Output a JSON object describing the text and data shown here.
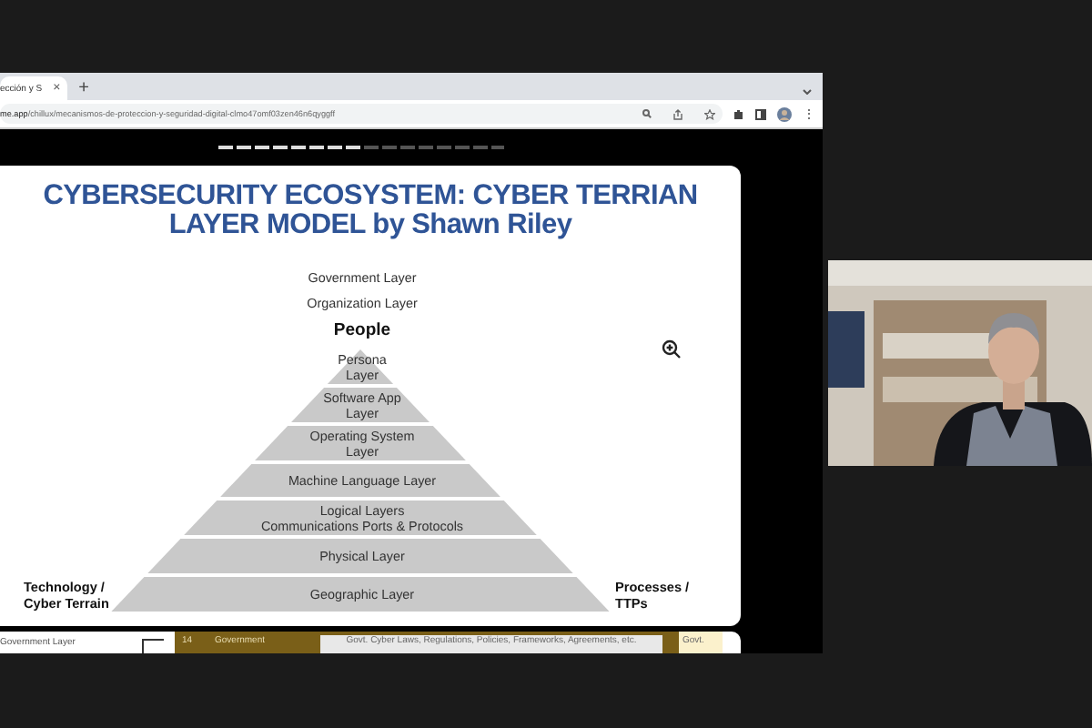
{
  "browser": {
    "tab_title": "ección y S",
    "tab_close": "×",
    "new_tab": "+",
    "url_host": "me.app",
    "url_path": "/chillux/mecanismos-de-proteccion-y-seguridad-digital-clmo47omf03zen46n6qyggff",
    "menu": "⋮"
  },
  "slide_progress": {
    "level": 0.5
  },
  "slide": {
    "title": "CYBERSECURITY ECOSYSTEM: CYBER TERRIAN LAYER MODEL by Shawn Riley",
    "top_labels": [
      {
        "text": "Government Layer",
        "kind": "plain"
      },
      {
        "text": "Organization Layer",
        "kind": "plain"
      },
      {
        "text": "People",
        "kind": "heading"
      }
    ],
    "layers": [
      {
        "lines": [
          "Persona",
          "Layer"
        ]
      },
      {
        "lines": [
          "Software App",
          "Layer"
        ]
      },
      {
        "lines": [
          "Operating System",
          "Layer"
        ]
      },
      {
        "lines": [
          "Machine Language Layer"
        ]
      },
      {
        "lines": [
          "Logical Layers",
          "Communications Ports & Protocols"
        ]
      },
      {
        "lines": [
          "Physical Layer"
        ]
      },
      {
        "lines": [
          "Geographic Layer"
        ]
      }
    ],
    "left_label": [
      "Technology /",
      "Cyber Terrain"
    ],
    "right_label": [
      "Processes /",
      "TTPs"
    ]
  },
  "next_slide": {
    "row_label": "Government Layer",
    "number": "14",
    "name": "Government",
    "description": "Govt. Cyber Laws, Regulations, Policies, Frameworks, Agreements, etc.",
    "tag": "Govt."
  }
}
